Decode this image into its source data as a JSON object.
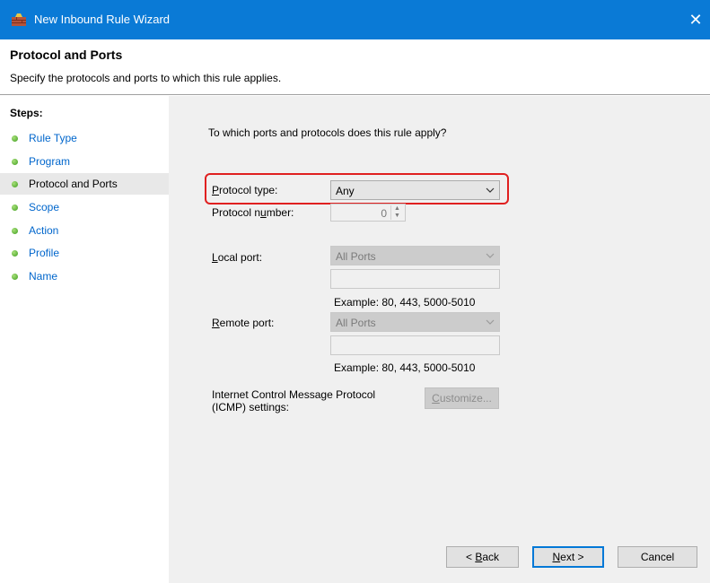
{
  "window": {
    "title": "New Inbound Rule Wizard",
    "close_glyph": "✕",
    "icon": "firewall-icon"
  },
  "header": {
    "title": "Protocol and Ports",
    "subtitle": "Specify the protocols and ports to which this rule applies."
  },
  "steps": {
    "label": "Steps:",
    "items": [
      {
        "label": "Rule Type"
      },
      {
        "label": "Program"
      },
      {
        "label": "Protocol and Ports",
        "current": true
      },
      {
        "label": "Scope"
      },
      {
        "label": "Action"
      },
      {
        "label": "Profile"
      },
      {
        "label": "Name"
      }
    ]
  },
  "form": {
    "question": "To which ports and protocols does this rule apply?",
    "protocol_type": {
      "label_u": "P",
      "label_rest": "rotocol type:",
      "value": "Any"
    },
    "protocol_number": {
      "label_pre": "Protocol n",
      "label_u": "u",
      "label_rest": "mber:",
      "value": "0"
    },
    "local_port": {
      "label_u": "L",
      "label_rest": "ocal port:",
      "value": "All Ports",
      "example": "Example: 80, 443, 5000-5010"
    },
    "remote_port": {
      "label_u": "R",
      "label_rest": "emote port:",
      "value": "All Ports",
      "example": "Example: 80, 443, 5000-5010"
    },
    "icmp": {
      "line1": "Internet Control Message Protocol",
      "line2": "(ICMP) settings:",
      "button_u": "C",
      "button_rest": "ustomize..."
    }
  },
  "buttons": {
    "back_pre": "< ",
    "back_u": "B",
    "back_rest": "ack",
    "next_u": "N",
    "next_rest": "ext >",
    "cancel": "Cancel"
  },
  "colors": {
    "titlebar": "#0a7ad6",
    "link": "#0066cc",
    "highlight": "#e02020",
    "step_dot": "#3f9e1f"
  }
}
